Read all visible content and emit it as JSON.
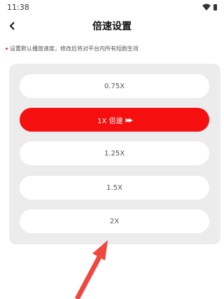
{
  "status": {
    "time": "11:38"
  },
  "header": {
    "title": "倍速设置"
  },
  "hint": "设置默认播放速度，修改后将对平台内所有短剧生效",
  "options": [
    {
      "label": "0.75X"
    },
    {
      "label": "1X 倍速",
      "icon": "▶▶",
      "selected": true
    },
    {
      "label": "1.25X"
    },
    {
      "label": "1.5X"
    },
    {
      "label": "2X"
    }
  ],
  "colors": {
    "accent": "#f50f0f",
    "panel": "#ececec",
    "annotation_arrow": "#f0473f"
  }
}
